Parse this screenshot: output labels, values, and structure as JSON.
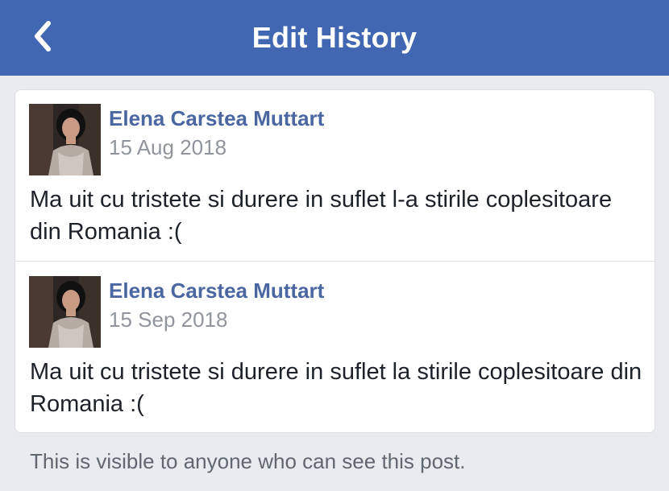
{
  "header": {
    "title": "Edit History",
    "back_icon": "chevron-left-icon",
    "background": "#4267b2"
  },
  "entries": [
    {
      "author": "Elena Carstea Muttart",
      "date": "15 Aug 2018",
      "text": "Ma uit cu tristete si durere in suflet l-a stirile coplesitoare din Romania :("
    },
    {
      "author": "Elena Carstea Muttart",
      "date": "15 Sep 2018",
      "text": "Ma uit cu tristete si durere in suflet la stirile coplesitoare din Romania :("
    }
  ],
  "footer": {
    "note": "This is visible to anyone who can see this post."
  },
  "colors": {
    "accent": "#4267b2",
    "author_link": "#4b67a1",
    "muted": "#90949c",
    "page_bg": "#e9ebee"
  }
}
